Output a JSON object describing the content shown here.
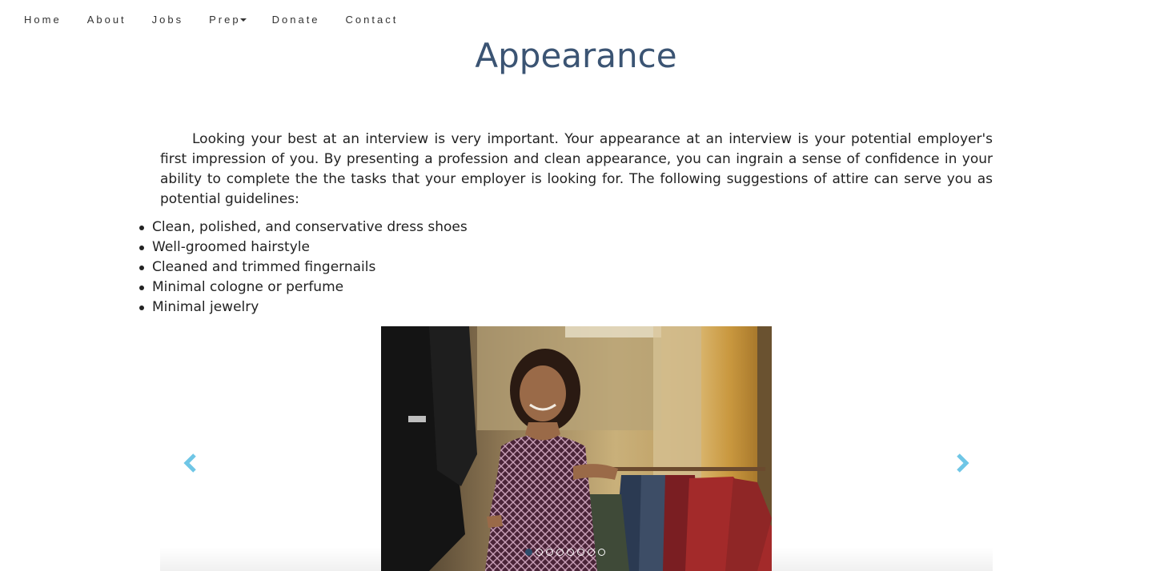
{
  "nav": {
    "items": [
      {
        "label": "Home"
      },
      {
        "label": "About"
      },
      {
        "label": "Jobs"
      },
      {
        "label": "Prep"
      },
      {
        "label": "Donate"
      },
      {
        "label": "Contact"
      }
    ]
  },
  "page": {
    "title": "Appearance",
    "intro": "Looking your best at an interview is very important. Your appearance at an interview is your potential employer's first impression of you. By presenting a profession and clean appearance, you can ingrain a sense of confidence in your ability to complete the the tasks that your employer is looking for. The following suggestions of attire can serve you as potential guidelines:",
    "tips": [
      "Clean, polished, and conservative dress shoes",
      "Well-groomed hairstyle",
      "Cleaned and trimmed fingernails",
      "Minimal cologne or perfume",
      "Minimal jewelry"
    ]
  },
  "carousel": {
    "slide_count": 8,
    "active_index": 0,
    "arrow_color": "#6fc6e6"
  },
  "colors": {
    "title": "#3b5473",
    "text": "#222222",
    "nav_text": "#333333",
    "active_dot": "#2c4d6b"
  }
}
